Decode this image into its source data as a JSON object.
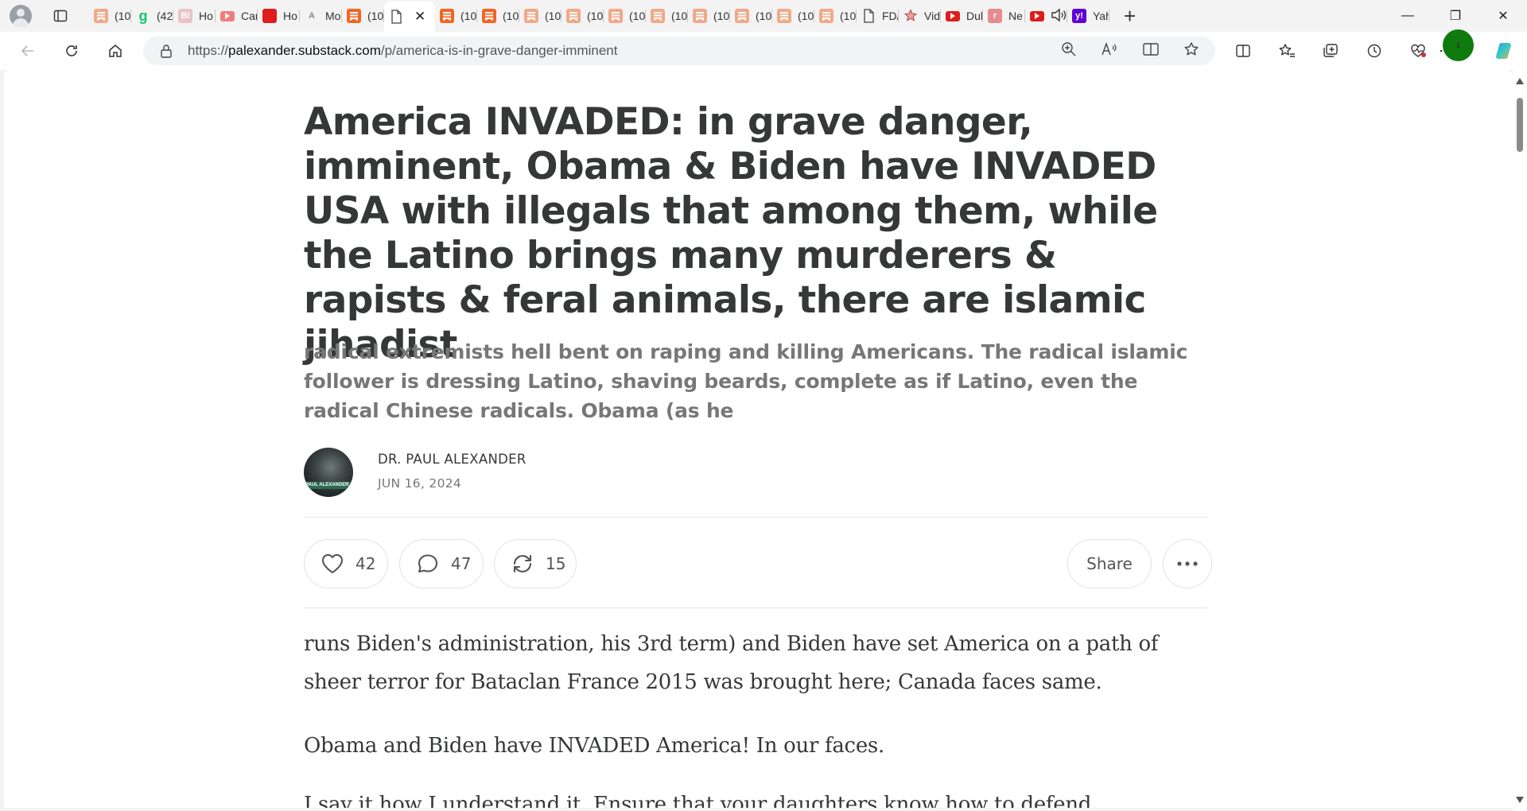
{
  "browser": {
    "tabs": [
      {
        "label": "(10",
        "icon": "substack-icon",
        "color": "#f0a98a",
        "glyph": ""
      },
      {
        "label": "(42",
        "icon": "grammarly-icon",
        "color": "#14c76b",
        "glyph": "g"
      },
      {
        "label": "Ho",
        "icon": "business-insider-icon",
        "color": "#e9c4c4",
        "glyph": "BI"
      },
      {
        "label": "Car",
        "icon": "youtube-icon",
        "color": "#f07c7c",
        "glyph": ""
      },
      {
        "label": "Ho",
        "icon": "pinned-news-icon",
        "color": "#e01c1c",
        "glyph": ""
      },
      {
        "label": "Mo",
        "icon": "ai-text-icon",
        "color": "#dddddd",
        "glyph": "A"
      },
      {
        "label": "(10",
        "icon": "substack-icon",
        "color": "#f26522",
        "glyph": ""
      },
      {
        "label": "",
        "icon": "page-icon",
        "color": "#ffffff",
        "glyph": "",
        "active": true
      },
      {
        "label": "(10",
        "icon": "substack-icon",
        "color": "#f26522",
        "glyph": ""
      },
      {
        "label": "(10",
        "icon": "substack-icon",
        "color": "#f26522",
        "glyph": ""
      },
      {
        "label": "(10",
        "icon": "substack-icon",
        "color": "#f0a98a",
        "glyph": ""
      },
      {
        "label": "(10",
        "icon": "substack-icon",
        "color": "#f0a98a",
        "glyph": ""
      },
      {
        "label": "(10",
        "icon": "substack-icon",
        "color": "#f0a98a",
        "glyph": ""
      },
      {
        "label": "(10",
        "icon": "substack-icon",
        "color": "#f0a98a",
        "glyph": ""
      },
      {
        "label": "(10",
        "icon": "substack-icon",
        "color": "#f0a98a",
        "glyph": ""
      },
      {
        "label": "(10",
        "icon": "substack-icon",
        "color": "#f0a98a",
        "glyph": ""
      },
      {
        "label": "(10",
        "icon": "substack-icon",
        "color": "#f0a98a",
        "glyph": ""
      },
      {
        "label": "(10",
        "icon": "substack-icon",
        "color": "#f0a98a",
        "glyph": ""
      },
      {
        "label": "FD/",
        "icon": "page-icon",
        "color": "#ffffff",
        "glyph": ""
      },
      {
        "label": "Vid",
        "icon": "star-icon",
        "color": "#ffffff",
        "glyph": ""
      },
      {
        "label": "Dul",
        "icon": "youtube-icon",
        "color": "#e01c1c",
        "glyph": ""
      },
      {
        "label": "Ne",
        "icon": "news-icon",
        "color": "#e58c8c",
        "glyph": "r"
      },
      {
        "label": "",
        "icon": "youtube-icon",
        "color": "#e01c1c",
        "glyph": ""
      },
      {
        "label": "Yah",
        "icon": "yahoo-icon",
        "color": "#6001d2",
        "glyph": "y!"
      }
    ],
    "url_prefix": "https://",
    "url_host": "palexander.substack.com",
    "url_path": "/p/america-is-in-grave-danger-imminent",
    "extension_badge": "1"
  },
  "post": {
    "title": "America INVADED: in grave danger, imminent, Obama & Biden have INVADED USA with illegals that among them, while the Latino brings many murderers & rapists & feral animals, there are islamic jihadist",
    "subtitle": "radical extremists hell bent on raping and killing Americans. The radical islamic follower is dressing Latino, shaving beards, complete as if Latino, even the radical Chinese radicals. Obama (as he",
    "author": "DR. PAUL ALEXANDER",
    "avatar_caption": "PAUL ALEXANDER",
    "date": "JUN 16, 2024",
    "likes": "42",
    "comments": "47",
    "restacks": "15",
    "share_label": "Share",
    "body": [
      "runs Biden's administration, his 3rd term) and Biden have set America on a path of sheer terror for Bataclan France 2015 was brought here; Canada faces same.",
      "Obama and Biden have INVADED America! In our faces.",
      "I say it how I understand it. Ensure that your daughters know how to defend"
    ]
  }
}
